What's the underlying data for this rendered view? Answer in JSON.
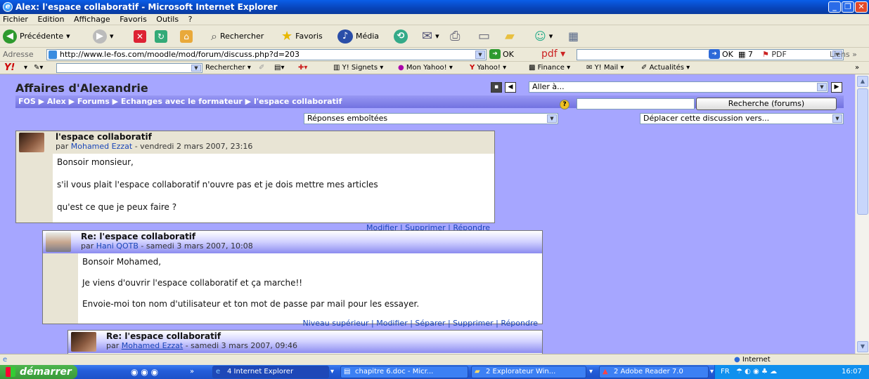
{
  "window": {
    "title": "Alex: l'espace collaboratif - Microsoft Internet Explorer"
  },
  "menu": [
    "Fichier",
    "Edition",
    "Affichage",
    "Favoris",
    "Outils",
    "?"
  ],
  "toolbar": {
    "back": "Précédente",
    "search": "Rechercher",
    "favorites": "Favoris",
    "media": "Média"
  },
  "address": {
    "label": "Adresse",
    "url": "http://www.le-fos.com/moodle/mod/forum/discuss.php?d=203",
    "go": "OK",
    "pdf": "pdf",
    "go2": "OK",
    "count": "7",
    "pdf_btn": "PDF",
    "links": "Liens"
  },
  "yahoo": {
    "search": "Rechercher",
    "signets": "Y! Signets",
    "monyahoo": "Mon Yahoo!",
    "yahoo": "Yahoo!",
    "finance": "Finance",
    "mail": "Y! Mail",
    "news": "Actualités"
  },
  "page": {
    "title": "Affaires d'Alexandrie",
    "jump": "Aller à...",
    "breadcrumb": [
      "FOS",
      "Alex",
      "Forums",
      "Echanges avec le formateur",
      "l'espace collaboratif"
    ],
    "search_button": "Recherche (forums)",
    "display_mode": "Réponses emboîtées",
    "move_discussion": "Déplacer cette discussion vers..."
  },
  "posts": [
    {
      "title": "l'espace collaboratif",
      "by": "par",
      "author": "Mohamed Ezzat",
      "date": "- vendredi 2 mars 2007, 23:16",
      "body": [
        "Bonsoir monsieur,",
        "s'il vous plait l'espace collaboratif n'ouvre pas et je dois mettre mes articles",
        "qu'est ce que je peux faire ?"
      ],
      "links": "Modifier | Supprimer | Répondre"
    },
    {
      "title": "Re: l'espace collaboratif",
      "by": "par",
      "author": "Hani QOTB",
      "date": "- samedi 3 mars 2007, 10:08",
      "body": [
        "Bonsoir Mohamed,",
        "Je viens d'ouvrir l'espace collaboratif et ça marche!!",
        "Envoie-moi ton nom d'utilisateur et ton mot de passe par mail pour les essayer."
      ],
      "links": "Niveau supérieur | Modifier | Séparer | Supprimer | Répondre"
    },
    {
      "title": "Re: l'espace collaboratif",
      "by": "par",
      "author": "Mohamed Ezzat",
      "date": "- samedi 3 mars 2007, 09:46"
    }
  ],
  "status": {
    "zone": "Internet"
  },
  "taskbar": {
    "start": "démarrer",
    "tasks": [
      "4 Internet Explorer",
      "chapitre 6.doc - Micr...",
      "2 Explorateur Win...",
      "2 Adobe Reader 7.0"
    ],
    "lang": "FR",
    "clock": "16:07"
  },
  "colors": {
    "page_bg": "#a6a6ff",
    "navbar": "#7272e0",
    "titlebar": "#0a5ee8",
    "link": "#1a46b8"
  }
}
